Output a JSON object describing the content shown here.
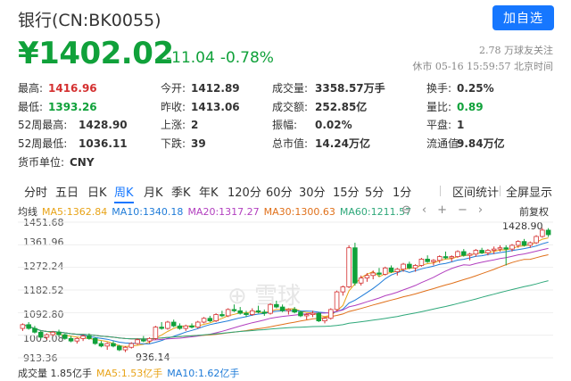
{
  "header": {
    "title": "银行(CN:BK0055)",
    "follow_label": "加自选",
    "price": "¥1402.02",
    "change": "-11.04",
    "change_pct": "-0.78%",
    "followers": "2.78 万球友关注",
    "status": "休市 05-16 15:59:57 北京时间"
  },
  "quotes": [
    {
      "label": "最高:",
      "value": "1416.96",
      "color": "#d43030"
    },
    {
      "label": "今开:",
      "value": "1412.89",
      "color": "#333333"
    },
    {
      "label": "成交量:",
      "value": "3358.57万手",
      "color": "#333333"
    },
    {
      "label": "换手:",
      "value": "0.25%",
      "color": "#333333"
    },
    {
      "label": "最低:",
      "value": "1393.26",
      "color": "#10a13a"
    },
    {
      "label": "昨收:",
      "value": "1413.06",
      "color": "#333333"
    },
    {
      "label": "成交额:",
      "value": "252.85亿",
      "color": "#333333"
    },
    {
      "label": "量比:",
      "value": "0.89",
      "color": "#10a13a"
    },
    {
      "label": "52周最高:",
      "value": "1428.90",
      "color": "#333333"
    },
    {
      "label": "上涨:",
      "value": "2",
      "color": "#333333"
    },
    {
      "label": "振幅:",
      "value": "0.02%",
      "color": "#333333"
    },
    {
      "label": "平盘:",
      "value": "1",
      "color": "#333333"
    },
    {
      "label": "52周最低:",
      "value": "1036.11",
      "color": "#333333"
    },
    {
      "label": "下跌:",
      "value": "39",
      "color": "#333333"
    },
    {
      "label": "总市值:",
      "value": "14.24万亿",
      "color": "#333333"
    },
    {
      "label": "流通值:",
      "value": "9.84万亿",
      "color": "#333333"
    },
    {
      "label": "货币单位:",
      "value": "CNY",
      "color": "#333333"
    }
  ],
  "tabs": [
    "分时",
    "五日",
    "日K",
    "周K",
    "月K",
    "季K",
    "年K",
    "120分",
    "60分",
    "30分",
    "15分",
    "5分",
    "1分"
  ],
  "active_tab": "周K",
  "tools": {
    "interval_stats": "区间统计",
    "fullscreen": "全屏显示",
    "adjust": "前复权"
  },
  "ma_legend": {
    "label": "均线",
    "items": [
      {
        "text": "MA5:1362.84",
        "color": "#e8a317"
      },
      {
        "text": "MA10:1340.18",
        "color": "#1e7bd8"
      },
      {
        "text": "MA20:1317.27",
        "color": "#b23fbf"
      },
      {
        "text": "MA30:1300.63",
        "color": "#e0701a"
      },
      {
        "text": "MA60:1211.57",
        "color": "#2ea87a"
      }
    ]
  },
  "vol_legend": {
    "items": [
      {
        "text": "成交量 1.85亿手",
        "color": "#333333"
      },
      {
        "text": "MA5:1.53亿手",
        "color": "#e8a317"
      },
      {
        "text": "MA10:1.62亿手",
        "color": "#1e7bd8"
      }
    ]
  },
  "y_axis_labels": [
    "1451.68",
    "1361.96",
    "1272.24",
    "1182.52",
    "1092.80",
    "1003.08",
    "913.36"
  ],
  "annotations": {
    "high": "1428.90",
    "low": "936.14"
  },
  "chart_data": {
    "type": "candlestick",
    "ylim": [
      913.36,
      1451.68
    ],
    "candles": [
      [
        1030,
        1050,
        1020,
        1045
      ],
      [
        1045,
        1055,
        1025,
        1030
      ],
      [
        1030,
        1040,
        1010,
        1015
      ],
      [
        1015,
        1020,
        990,
        995
      ],
      [
        995,
        1010,
        985,
        1005
      ],
      [
        1005,
        1020,
        1000,
        1015
      ],
      [
        1015,
        1025,
        1000,
        1005
      ],
      [
        1005,
        1010,
        985,
        990
      ],
      [
        990,
        1000,
        975,
        980
      ],
      [
        980,
        995,
        970,
        990
      ],
      [
        990,
        1005,
        980,
        1000
      ],
      [
        1000,
        1010,
        985,
        990
      ],
      [
        990,
        995,
        965,
        970
      ],
      [
        970,
        980,
        955,
        960
      ],
      [
        960,
        975,
        945,
        970
      ],
      [
        970,
        980,
        955,
        960
      ],
      [
        960,
        965,
        940,
        945
      ],
      [
        945,
        960,
        936,
        955
      ],
      [
        955,
        975,
        950,
        970
      ],
      [
        970,
        990,
        965,
        985
      ],
      [
        985,
        1000,
        975,
        980
      ],
      [
        980,
        995,
        970,
        990
      ],
      [
        990,
        1040,
        985,
        1035
      ],
      [
        1035,
        1055,
        1025,
        1030
      ],
      [
        1030,
        1060,
        1025,
        1055
      ],
      [
        1055,
        1065,
        1035,
        1040
      ],
      [
        1040,
        1050,
        1025,
        1030
      ],
      [
        1030,
        1045,
        1020,
        1040
      ],
      [
        1040,
        1050,
        1030,
        1035
      ],
      [
        1035,
        1060,
        1030,
        1055
      ],
      [
        1055,
        1075,
        1050,
        1070
      ],
      [
        1070,
        1080,
        1055,
        1060
      ],
      [
        1060,
        1090,
        1055,
        1085
      ],
      [
        1085,
        1100,
        1075,
        1080
      ],
      [
        1080,
        1110,
        1075,
        1105
      ],
      [
        1105,
        1125,
        1095,
        1100
      ],
      [
        1100,
        1115,
        1085,
        1090
      ],
      [
        1090,
        1100,
        1075,
        1085
      ],
      [
        1085,
        1110,
        1080,
        1100
      ],
      [
        1100,
        1120,
        1090,
        1095
      ],
      [
        1095,
        1105,
        1080,
        1090
      ],
      [
        1090,
        1130,
        1085,
        1125
      ],
      [
        1125,
        1140,
        1110,
        1115
      ],
      [
        1115,
        1125,
        1095,
        1100
      ],
      [
        1100,
        1110,
        1085,
        1105
      ],
      [
        1105,
        1115,
        1090,
        1095
      ],
      [
        1095,
        1100,
        1075,
        1080
      ],
      [
        1080,
        1090,
        1065,
        1085
      ],
      [
        1085,
        1100,
        1075,
        1090
      ],
      [
        1090,
        1095,
        1055,
        1060
      ],
      [
        1060,
        1075,
        1050,
        1070
      ],
      [
        1070,
        1110,
        1065,
        1105
      ],
      [
        1105,
        1180,
        1100,
        1175
      ],
      [
        1175,
        1200,
        1160,
        1195
      ],
      [
        1195,
        1360,
        1190,
        1350
      ],
      [
        1350,
        1370,
        1200,
        1210
      ],
      [
        1210,
        1240,
        1200,
        1230
      ],
      [
        1230,
        1250,
        1215,
        1240
      ],
      [
        1240,
        1260,
        1225,
        1250
      ],
      [
        1250,
        1270,
        1235,
        1245
      ],
      [
        1245,
        1275,
        1240,
        1270
      ],
      [
        1270,
        1280,
        1250,
        1255
      ],
      [
        1255,
        1270,
        1240,
        1265
      ],
      [
        1265,
        1290,
        1255,
        1285
      ],
      [
        1285,
        1295,
        1265,
        1270
      ],
      [
        1270,
        1285,
        1255,
        1280
      ],
      [
        1280,
        1310,
        1275,
        1305
      ],
      [
        1305,
        1320,
        1290,
        1295
      ],
      [
        1295,
        1305,
        1280,
        1300
      ],
      [
        1300,
        1320,
        1290,
        1315
      ],
      [
        1315,
        1335,
        1305,
        1310
      ],
      [
        1310,
        1320,
        1295,
        1315
      ],
      [
        1315,
        1340,
        1310,
        1335
      ],
      [
        1335,
        1345,
        1315,
        1320
      ],
      [
        1320,
        1330,
        1300,
        1325
      ],
      [
        1325,
        1345,
        1315,
        1340
      ],
      [
        1340,
        1350,
        1325,
        1330
      ],
      [
        1330,
        1345,
        1320,
        1340
      ],
      [
        1340,
        1355,
        1325,
        1345
      ],
      [
        1345,
        1360,
        1335,
        1350
      ],
      [
        1350,
        1360,
        1280,
        1345
      ],
      [
        1345,
        1365,
        1335,
        1360
      ],
      [
        1360,
        1380,
        1350,
        1375
      ],
      [
        1375,
        1385,
        1355,
        1360
      ],
      [
        1360,
        1375,
        1350,
        1370
      ],
      [
        1370,
        1400,
        1365,
        1395
      ],
      [
        1395,
        1429,
        1390,
        1420
      ],
      [
        1420,
        1428,
        1393,
        1402
      ]
    ]
  }
}
